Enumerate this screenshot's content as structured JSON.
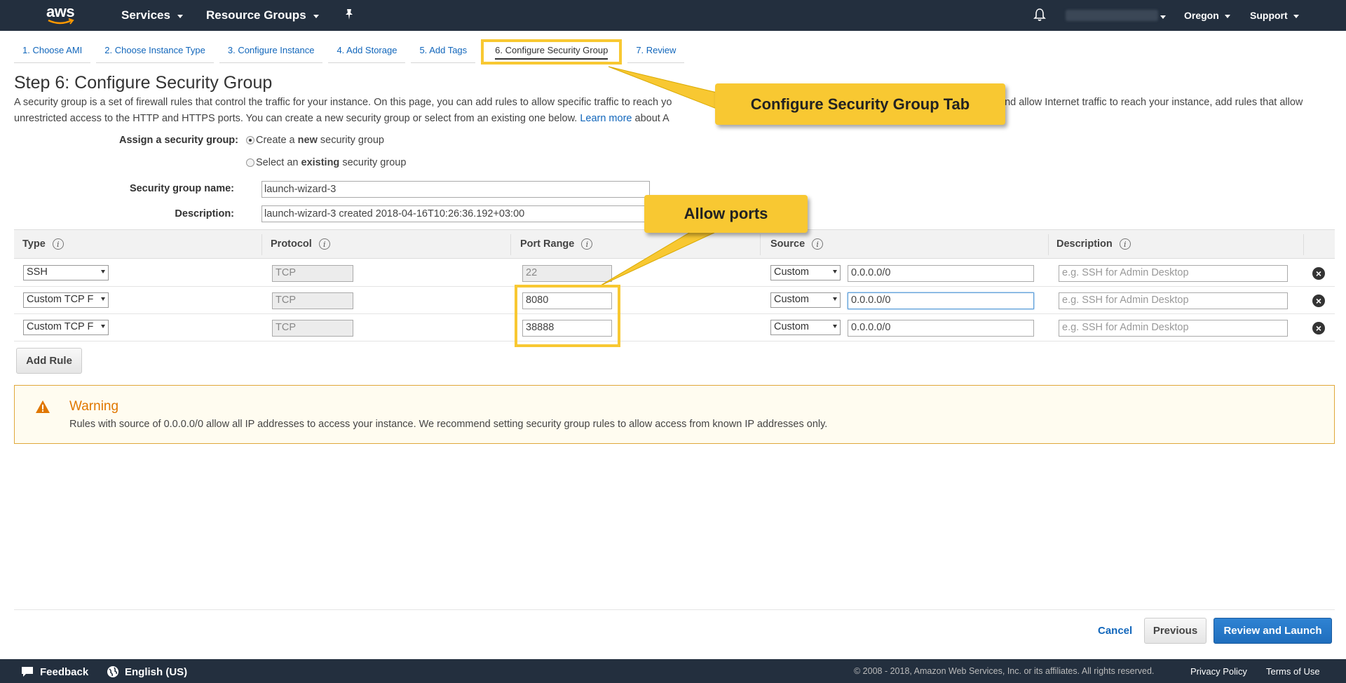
{
  "nav": {
    "logo": "aws",
    "services": "Services",
    "resource_groups": "Resource Groups",
    "region": "Oregon",
    "support": "Support"
  },
  "tabs": [
    {
      "label": "1. Choose AMI"
    },
    {
      "label": "2. Choose Instance Type"
    },
    {
      "label": "3. Configure Instance"
    },
    {
      "label": "4. Add Storage"
    },
    {
      "label": "5. Add Tags"
    },
    {
      "label": "6. Configure Security Group"
    },
    {
      "label": "7. Review"
    }
  ],
  "page": {
    "title": "Step 6: Configure Security Group",
    "intro_1": "A security group is a set of firewall rules that control the traffic for your instance. On this page, you can add rules to allow specific traffic to reach yo",
    "intro_2": "and allow Internet traffic to reach your instance, add rules that allow",
    "intro_3": "unrestricted access to the HTTP and HTTPS ports. You can create a new security group or select from an existing one below.",
    "learn_more": "Learn more",
    "intro_4": "about A"
  },
  "form": {
    "assign_label": "Assign a security group:",
    "option_new_pre": "Create a ",
    "option_new_bold": "new",
    "option_new_post": " security group",
    "option_existing_pre": "Select an ",
    "option_existing_bold": "existing",
    "option_existing_post": " security group",
    "name_label": "Security group name:",
    "name_value": "launch-wizard-3",
    "desc_label": "Description:",
    "desc_value": "launch-wizard-3 created 2018-04-16T10:26:36.192+03:00"
  },
  "table": {
    "headers": {
      "type": "Type",
      "protocol": "Protocol",
      "port_range": "Port Range",
      "source": "Source",
      "description": "Description"
    },
    "rows": [
      {
        "type": "SSH",
        "protocol": "TCP",
        "port": "22",
        "source_mode": "Custom",
        "source_cidr": "0.0.0.0/0",
        "desc_placeholder": "e.g. SSH for Admin Desktop"
      },
      {
        "type": "Custom TCP F",
        "protocol": "TCP",
        "port": "8080",
        "source_mode": "Custom",
        "source_cidr": "0.0.0.0/0",
        "desc_placeholder": "e.g. SSH for Admin Desktop"
      },
      {
        "type": "Custom TCP F",
        "protocol": "TCP",
        "port": "38888",
        "source_mode": "Custom",
        "source_cidr": "0.0.0.0/0",
        "desc_placeholder": "e.g. SSH for Admin Desktop"
      }
    ],
    "add_rule": "Add Rule"
  },
  "warning": {
    "title": "Warning",
    "text": "Rules with source of 0.0.0.0/0 allow all IP addresses to access your instance. We recommend setting security group rules to allow access from known IP addresses only."
  },
  "actions": {
    "cancel": "Cancel",
    "previous": "Previous",
    "review_launch": "Review and Launch"
  },
  "footer": {
    "feedback": "Feedback",
    "language": "English (US)",
    "copyright": "© 2008 - 2018, Amazon Web Services, Inc. or its affiliates. All rights reserved.",
    "privacy": "Privacy Policy",
    "terms": "Terms of Use"
  },
  "annotations": {
    "tab_callout": "Configure Security Group Tab",
    "ports_callout": "Allow ports"
  },
  "colors": {
    "nav_bg": "#232f3e",
    "highlight": "#f8c832",
    "link": "#1166bb",
    "warning_title": "#e07700",
    "primary_button": "#1f6ebd"
  }
}
